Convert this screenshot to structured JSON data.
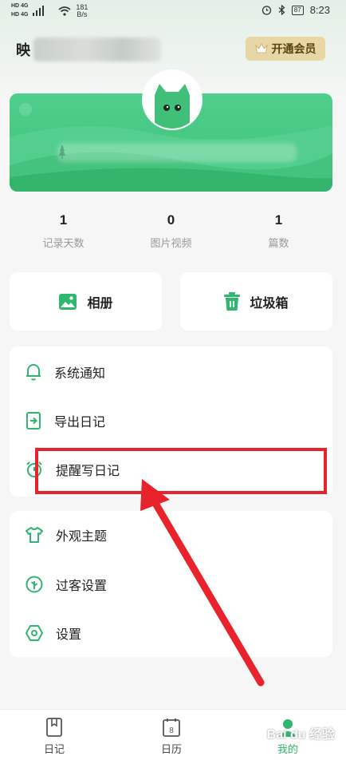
{
  "status_bar": {
    "hd1": "HD",
    "net1": "4G",
    "hd2": "HD",
    "net2": "4G",
    "speed_value": "181",
    "speed_unit": "B/s",
    "battery": "87",
    "time": "8:23"
  },
  "header": {
    "name_initial": "映",
    "vip_label": "开通会员"
  },
  "stats": [
    {
      "value": "1",
      "label": "记录天数"
    },
    {
      "value": "0",
      "label": "图片视频"
    },
    {
      "value": "1",
      "label": "篇数"
    }
  ],
  "quick_actions": {
    "album": "相册",
    "trash": "垃圾箱"
  },
  "menu_group1": [
    {
      "label": "系统通知",
      "icon": "bell-icon"
    },
    {
      "label": "导出日记",
      "icon": "export-icon"
    },
    {
      "label": "提醒写日记",
      "icon": "alarm-icon"
    }
  ],
  "menu_group2": [
    {
      "label": "外观主题",
      "icon": "shirt-icon"
    },
    {
      "label": "过客设置",
      "icon": "leaf-icon"
    },
    {
      "label": "设置",
      "icon": "settings-icon"
    }
  ],
  "bottom_nav": {
    "diary": "日记",
    "calendar": "日历",
    "calendar_day": "8",
    "mine": "我的"
  },
  "watermark": "Bai du 经验",
  "colors": {
    "brand_green": "#2fb66f",
    "highlight_red": "#e8232c",
    "vip_gold": "#e8d7a6"
  }
}
